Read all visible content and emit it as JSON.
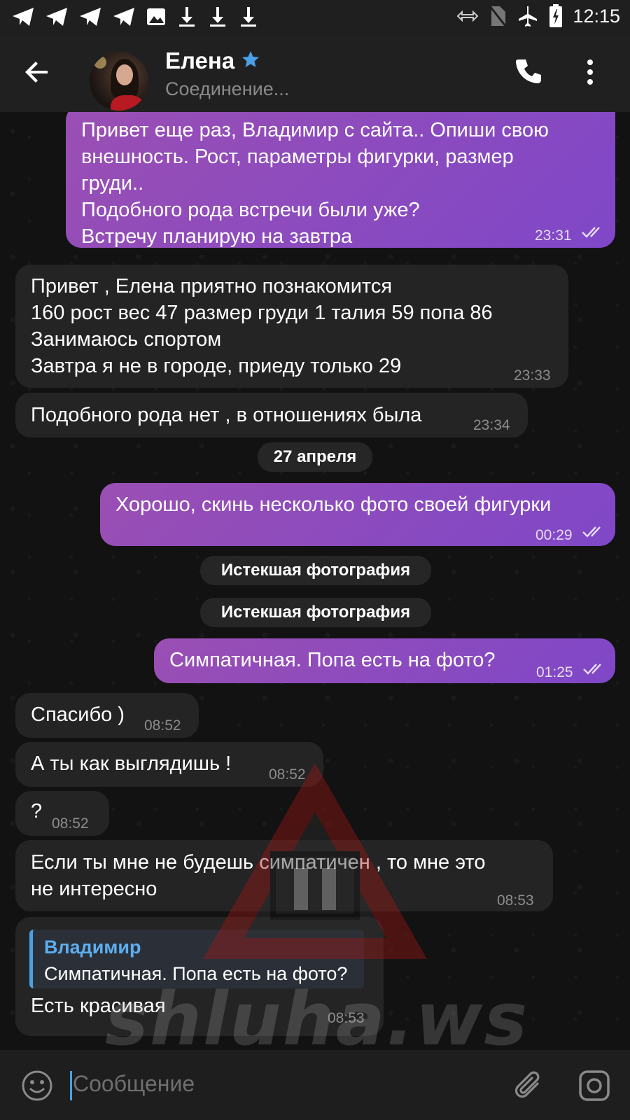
{
  "status_bar": {
    "time": "12:15"
  },
  "header": {
    "contact_name": "Елена",
    "status": "Соединение..."
  },
  "messages": [
    {
      "dir": "out",
      "text": "Привет еще раз, Владимир с сайта.. Опиши свою\nвнешность. Рост, параметры фигурки, размер\nгруди..\nПодобного рода встречи были уже?\nВстречу планирую на завтра",
      "time": "23:31"
    },
    {
      "dir": "in",
      "text": "Привет , Елена приятно познакомится\n160 рост вес 47 размер груди 1 талия 59 попа 86\nЗанимаюсь спортом\nЗавтра я не в городе, приеду только 29",
      "time": "23:33"
    },
    {
      "dir": "in",
      "text": "Подобного рода нет , в отношениях была",
      "time": "23:34"
    },
    {
      "dir": "out",
      "text": "Хорошо, скинь несколько фото своей фигурки",
      "time": "00:29"
    },
    {
      "dir": "out",
      "text": "Симпатичная. Попа есть на фото?",
      "time": "01:25"
    },
    {
      "dir": "in",
      "text": "Спасибо )",
      "time": "08:52"
    },
    {
      "dir": "in",
      "text": "А ты как выглядишь !",
      "time": "08:52"
    },
    {
      "dir": "in",
      "text": "?",
      "time": "08:52"
    },
    {
      "dir": "in",
      "text": "Если ты мне не будешь симпатичен , то мне это\nне интересно",
      "time": "08:53"
    },
    {
      "dir": "in",
      "text": "Есть красивая",
      "time": "08:53",
      "reply_name": "Владимир",
      "reply_text": "Симпатичная. Попа есть на фото?"
    }
  ],
  "date_divider": "27 апреля",
  "service_messages": [
    "Истекшая фотография",
    "Истекшая фотография"
  ],
  "watermark_text": "shluha.ws",
  "input": {
    "placeholder": "Сообщение"
  },
  "colors": {
    "out_bubble": "#8a4cc0",
    "in_bubble": "#242424",
    "accent": "#4aa0e6"
  },
  "icons": [
    "telegram-icon",
    "image-icon",
    "download-icon",
    "back-arrow-icon",
    "star-icon",
    "phone-icon",
    "more-vertical-icon",
    "double-check-icon",
    "emoji-icon",
    "attach-icon",
    "camera-icon"
  ]
}
